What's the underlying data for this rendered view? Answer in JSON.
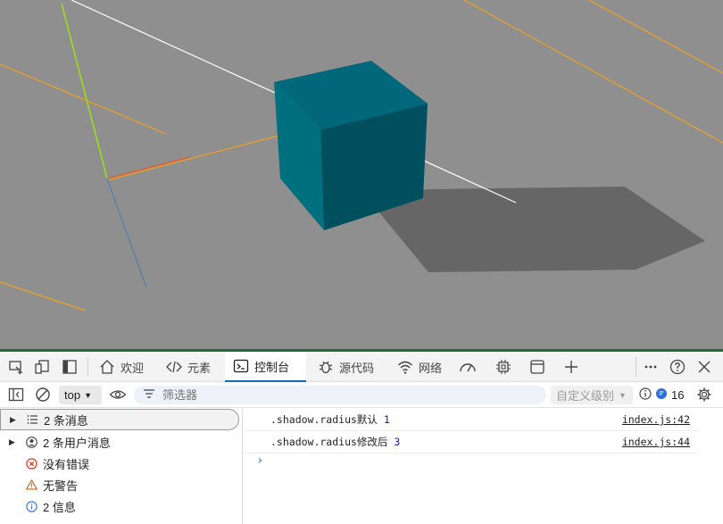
{
  "devtools": {
    "tabs": [
      {
        "label": "欢迎",
        "icon": "home-icon"
      },
      {
        "label": "元素",
        "icon": "code-icon"
      },
      {
        "label": "控制台",
        "icon": "console-icon"
      },
      {
        "label": "源代码",
        "icon": "bug-icon"
      },
      {
        "label": "网络",
        "icon": "wifi-icon"
      },
      {
        "label": "",
        "icon": "performance-icon"
      },
      {
        "label": "",
        "icon": "cpu-icon"
      },
      {
        "label": "",
        "icon": "application-icon"
      }
    ],
    "active_tab": "控制台"
  },
  "console_toolbar": {
    "context": "top",
    "filter_placeholder": "筛选器",
    "levels_label": "自定义级别",
    "issue_count": "16"
  },
  "sidebar": {
    "items": [
      {
        "label": "2 条消息",
        "icon": "list-icon"
      },
      {
        "label": "2 条用户消息",
        "icon": "user-icon"
      },
      {
        "label": "没有错误",
        "icon": "error-icon"
      },
      {
        "label": "无警告",
        "icon": "warning-icon"
      },
      {
        "label": "2 信息",
        "icon": "info-icon"
      }
    ]
  },
  "messages": [
    {
      "text": ".shadow.radius默认 ",
      "value": "1",
      "source": "index.js:42"
    },
    {
      "text": ".shadow.radius修改后 ",
      "value": "3",
      "source": "index.js:44"
    }
  ],
  "colors": {
    "scene_bg": "#8f8f8f",
    "cube_front": "#005a6a",
    "cube_top": "#00687a",
    "shadow": "#666666",
    "grid_line": "#f0a020",
    "accent": "#0f6cbd"
  }
}
